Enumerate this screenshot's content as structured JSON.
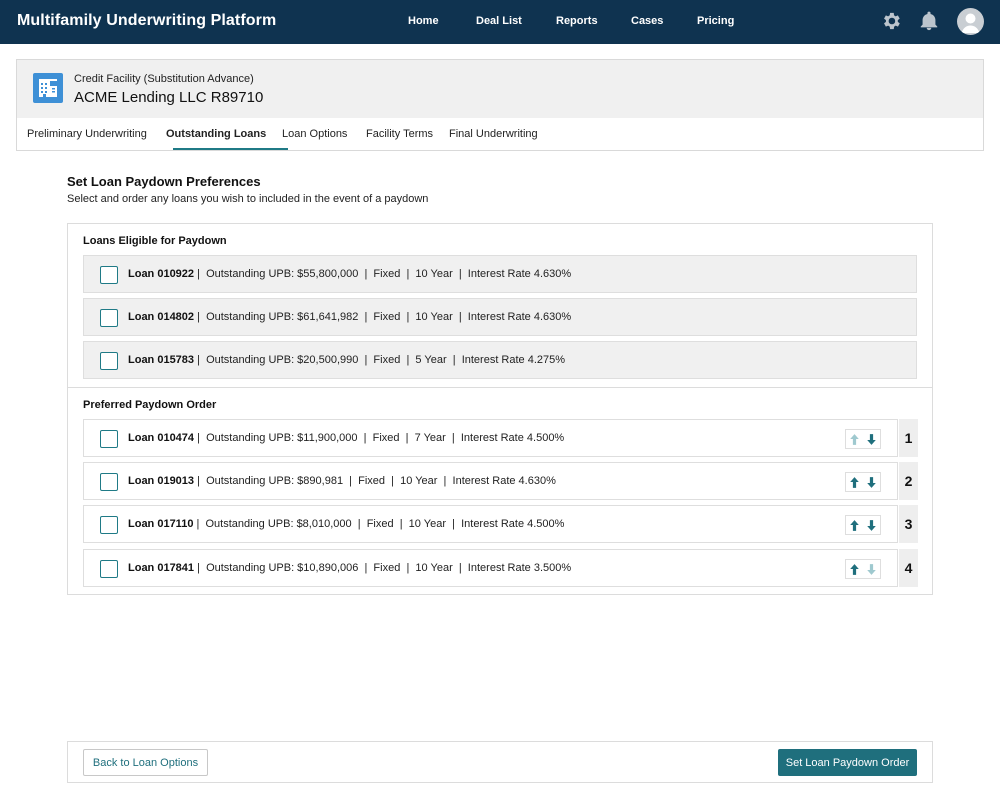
{
  "app": {
    "title": "Multifamily Underwriting Platform"
  },
  "nav": {
    "links": [
      "Home",
      "Deal List",
      "Reports",
      "Cases",
      "Pricing"
    ],
    "icons": [
      "gear-icon",
      "bell-icon",
      "user-avatar"
    ]
  },
  "header": {
    "subtitle": "Credit Facility (Substitution Advance)",
    "entity": "ACME Lending LLC R89710",
    "tabs": [
      {
        "label": "Preliminary Underwriting",
        "active": false
      },
      {
        "label": "Outstanding Loans",
        "active": true
      },
      {
        "label": "Loan Options",
        "active": false
      },
      {
        "label": "Facility Terms",
        "active": false
      },
      {
        "label": "Final Underwriting",
        "active": false
      }
    ]
  },
  "section": {
    "title": "Set Loan Paydown Preferences",
    "subtitle": "Select and order any loans you wish to included in the event of a paydown"
  },
  "eligible": {
    "title": "Loans Eligible for Paydown",
    "loans": [
      {
        "id": "Loan 010922",
        "details": " |  Outstanding UPB: $55,800,000  |  Fixed  |  10 Year  |  Interest Rate 4.630%",
        "checked": false
      },
      {
        "id": "Loan 014802",
        "details": " |  Outstanding UPB: $61,641,982  |  Fixed  |  10 Year  |  Interest Rate 4.630%",
        "checked": false
      },
      {
        "id": "Loan 015783",
        "details": " |  Outstanding UPB: $20,500,990  |  Fixed  |  5 Year  |  Interest Rate 4.275%",
        "checked": false
      }
    ]
  },
  "preferred": {
    "title": "Preferred Paydown Order",
    "loans": [
      {
        "id": "Loan 010474",
        "details": " |  Outstanding UPB: $11,900,000  |  Fixed  |  7 Year  |  Interest Rate 4.500%",
        "rank": "1",
        "up_enabled": false,
        "down_enabled": true
      },
      {
        "id": "Loan 019013",
        "details": " |  Outstanding UPB: $890,981  |  Fixed  |  10 Year  |  Interest Rate 4.630%",
        "rank": "2",
        "up_enabled": true,
        "down_enabled": true
      },
      {
        "id": "Loan 017110",
        "details": " |  Outstanding UPB: $8,010,000  |  Fixed  |  10 Year  |  Interest Rate 4.500%",
        "rank": "3",
        "up_enabled": true,
        "down_enabled": true
      },
      {
        "id": "Loan 017841",
        "details": " |  Outstanding UPB: $10,890,006  |  Fixed  |  10 Year  |  Interest Rate 3.500%",
        "rank": "4",
        "up_enabled": true,
        "down_enabled": false
      }
    ]
  },
  "footer": {
    "back_label": "Back to Loan Options",
    "submit_label": "Set Loan Paydown Order"
  },
  "colors": {
    "topbar": "#0f3350",
    "accent": "#1f6f7d",
    "icon_blue": "#3e90d6",
    "arrow_enabled": "#1f6f7d",
    "arrow_disabled": "#9fc9cf"
  }
}
